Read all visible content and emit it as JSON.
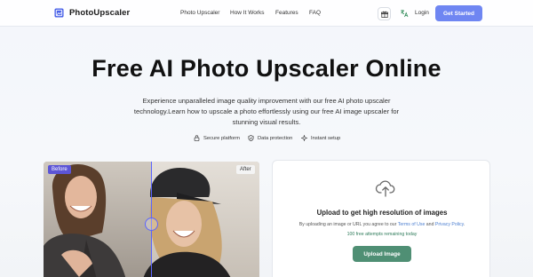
{
  "header": {
    "brand": "PhotoUpscaler",
    "nav": [
      "Photo Upscaler",
      "How It Works",
      "Features",
      "FAQ"
    ],
    "login": "Login",
    "cta": "Get Started"
  },
  "hero": {
    "title": "Free AI Photo Upscaler Online",
    "subtitle": "Experience unparalleled image quality improvement with our free AI photo upscaler technology.Learn how to upscale a photo effortlessly using our free AI image upscaler for stunning visual results.",
    "features": [
      "Secure platform",
      "Data protection",
      "Instant setup"
    ]
  },
  "compare": {
    "before_label": "Before",
    "after_label": "After"
  },
  "upload": {
    "title": "Upload to get high resolution of images",
    "terms_prefix": "By uploading an image or URL you agree to our",
    "terms_link": "Terms of Use",
    "terms_and": "and",
    "privacy_link": "Privacy Policy",
    "terms_suffix": ".",
    "remaining": "100 free attempts remaining today",
    "button": "Upload Image"
  },
  "colors": {
    "brand_accent": "#6f86f2",
    "upload_button": "#4f8f74",
    "before_tag": "#5c55d6",
    "divider": "#5b64ff"
  }
}
